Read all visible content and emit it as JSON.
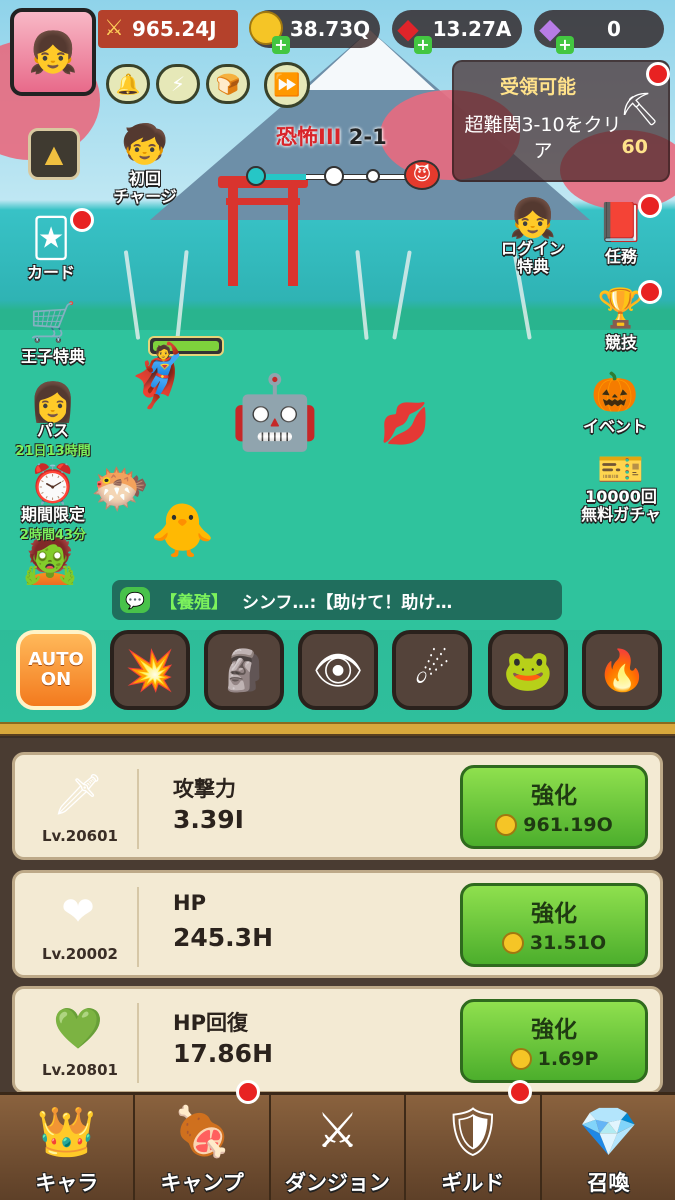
{
  "colors": {
    "accent_green": "#4cae2c",
    "danger_red": "#e82222",
    "gold": "#f5c526",
    "panel_bg": "#f3ead3"
  },
  "header": {
    "combat_power": "965.24J",
    "gold": "38.73Q",
    "ruby": "13.27A",
    "gem": "0"
  },
  "stage": {
    "name": "恐怖III",
    "number": "2-1",
    "progress": 0.3
  },
  "quest": {
    "heading": "受領可能",
    "text": "超難関3-10をクリア",
    "reward": "60"
  },
  "side_left": [
    {
      "label": "初回\nチャージ",
      "icon": "treasure-chest-icon"
    },
    {
      "label": "カード",
      "icon": "cards-icon"
    },
    {
      "label": "王子特典",
      "icon": "cart-icon"
    },
    {
      "label": "パス",
      "sub": "21日13時間",
      "icon": "pass-icon"
    },
    {
      "label": "期間限定",
      "sub": "2時間43分",
      "icon": "clock-gift-icon"
    }
  ],
  "side_right": [
    {
      "label": "ログイン\n特典",
      "icon": "login-bonus-icon"
    },
    {
      "label": "任務",
      "icon": "book-icon"
    },
    {
      "label": "競技",
      "icon": "trophy-icon"
    },
    {
      "label": "イベント",
      "icon": "pinwheel-icon"
    },
    {
      "label": "10000回\n無料ガチャ",
      "icon": "ticket-icon"
    }
  ],
  "chat": {
    "category": "【養殖】",
    "message": "シンフ…:【助けて！助け…"
  },
  "skill_bar": {
    "auto_label_1": "AUTO",
    "auto_label_2": "ON"
  },
  "stats": [
    {
      "name": "攻撃力",
      "value": "3.39I",
      "level": "Lv.20601",
      "upgrade_label": "強化",
      "cost": "961.19O",
      "icon": "sword-icon"
    },
    {
      "name": "HP",
      "value": "245.3H",
      "level": "Lv.20002",
      "upgrade_label": "強化",
      "cost": "31.51O",
      "icon": "heart-icon"
    },
    {
      "name": "HP回復",
      "value": "17.86H",
      "level": "Lv.20801",
      "upgrade_label": "強化",
      "cost": "1.69P",
      "icon": "heal-icon"
    }
  ],
  "tabs": [
    {
      "label": "キャラ",
      "icon": "crown-icon"
    },
    {
      "label": "キャンプ",
      "icon": "campfire-icon"
    },
    {
      "label": "ダンジョン",
      "icon": "dungeon-swords-icon"
    },
    {
      "label": "ギルド",
      "icon": "guild-shield-icon"
    },
    {
      "label": "召喚",
      "icon": "summon-altar-icon"
    }
  ]
}
